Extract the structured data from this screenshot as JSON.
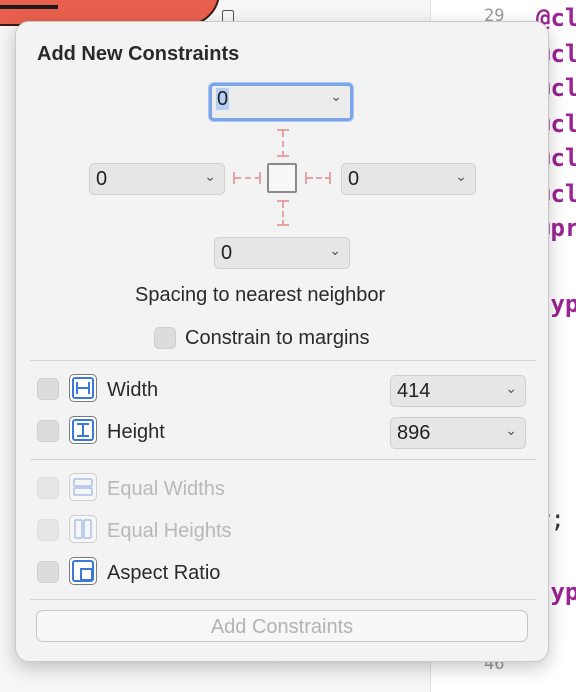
{
  "editor": {
    "line_numbers": [
      "29",
      "46"
    ],
    "code_fragments": [
      "@cl",
      "@cl",
      "@cl",
      "@cl",
      "@cl",
      "@cl",
      "@pr",
      "typ",
      "r;",
      "typ"
    ]
  },
  "popover": {
    "title": "Add New Constraints",
    "spacing": {
      "top": "0",
      "left": "0",
      "right": "0",
      "bottom": "0",
      "caption": "Spacing to nearest neighbor"
    },
    "constrain_to_margins": {
      "label": "Constrain to margins",
      "checked": false
    },
    "width": {
      "label": "Width",
      "value": "414",
      "checked": false
    },
    "height": {
      "label": "Height",
      "value": "896",
      "checked": false
    },
    "equal_widths": {
      "label": "Equal Widths",
      "enabled": false
    },
    "equal_heights": {
      "label": "Equal Heights",
      "enabled": false
    },
    "aspect_ratio": {
      "label": "Aspect Ratio",
      "checked": false
    },
    "add_button": "Add Constraints"
  },
  "colors": {
    "accent_focus": "#7ba4e9",
    "constraint_guide": "#e6a3a3",
    "icon_blue": "#3b79d8",
    "keyword_purple": "#9b2393",
    "tab_red": "#e8604d"
  }
}
